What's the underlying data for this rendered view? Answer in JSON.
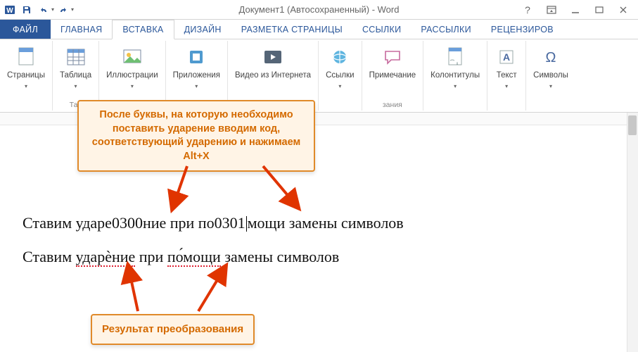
{
  "title": "Документ1 (Автосохраненный) - Word",
  "tabs": {
    "file": "ФАЙЛ",
    "home": "ГЛАВНАЯ",
    "insert": "ВСТАВКА",
    "design": "ДИЗАЙН",
    "layout": "РАЗМЕТКА СТРАНИЦЫ",
    "references": "ССЫЛКИ",
    "mailings": "РАССЫЛКИ",
    "review": "РЕЦЕНЗИРОВ"
  },
  "ribbon": {
    "pages": "Страницы",
    "table": "Таблица",
    "table_group": "Таб",
    "illustrations": "Иллюстрации",
    "apps": "Приложения",
    "video": "Видео из Интернета",
    "links": "Ссылки",
    "comment": "Примечание",
    "comment_group": "зания",
    "headerfooter": "Колонтитулы",
    "text": "Текст",
    "symbols": "Символы"
  },
  "callouts": {
    "top": "После буквы, на которую необходимо поставить ударение вводим код, соответствующий ударению и нажимаем Alt+X",
    "bottom": "Результат преобразования"
  },
  "document": {
    "line1_a": "Ставим ударе",
    "line1_b": "0300",
    "line1_c": "ние при по",
    "line1_d": "0301",
    "line1_e": "мощи замены символов",
    "line2_a": "Ставим ",
    "line2_b": "ударѐние",
    "line2_c": " при ",
    "line2_d": "по́мощи",
    "line2_e": " замены символов"
  }
}
